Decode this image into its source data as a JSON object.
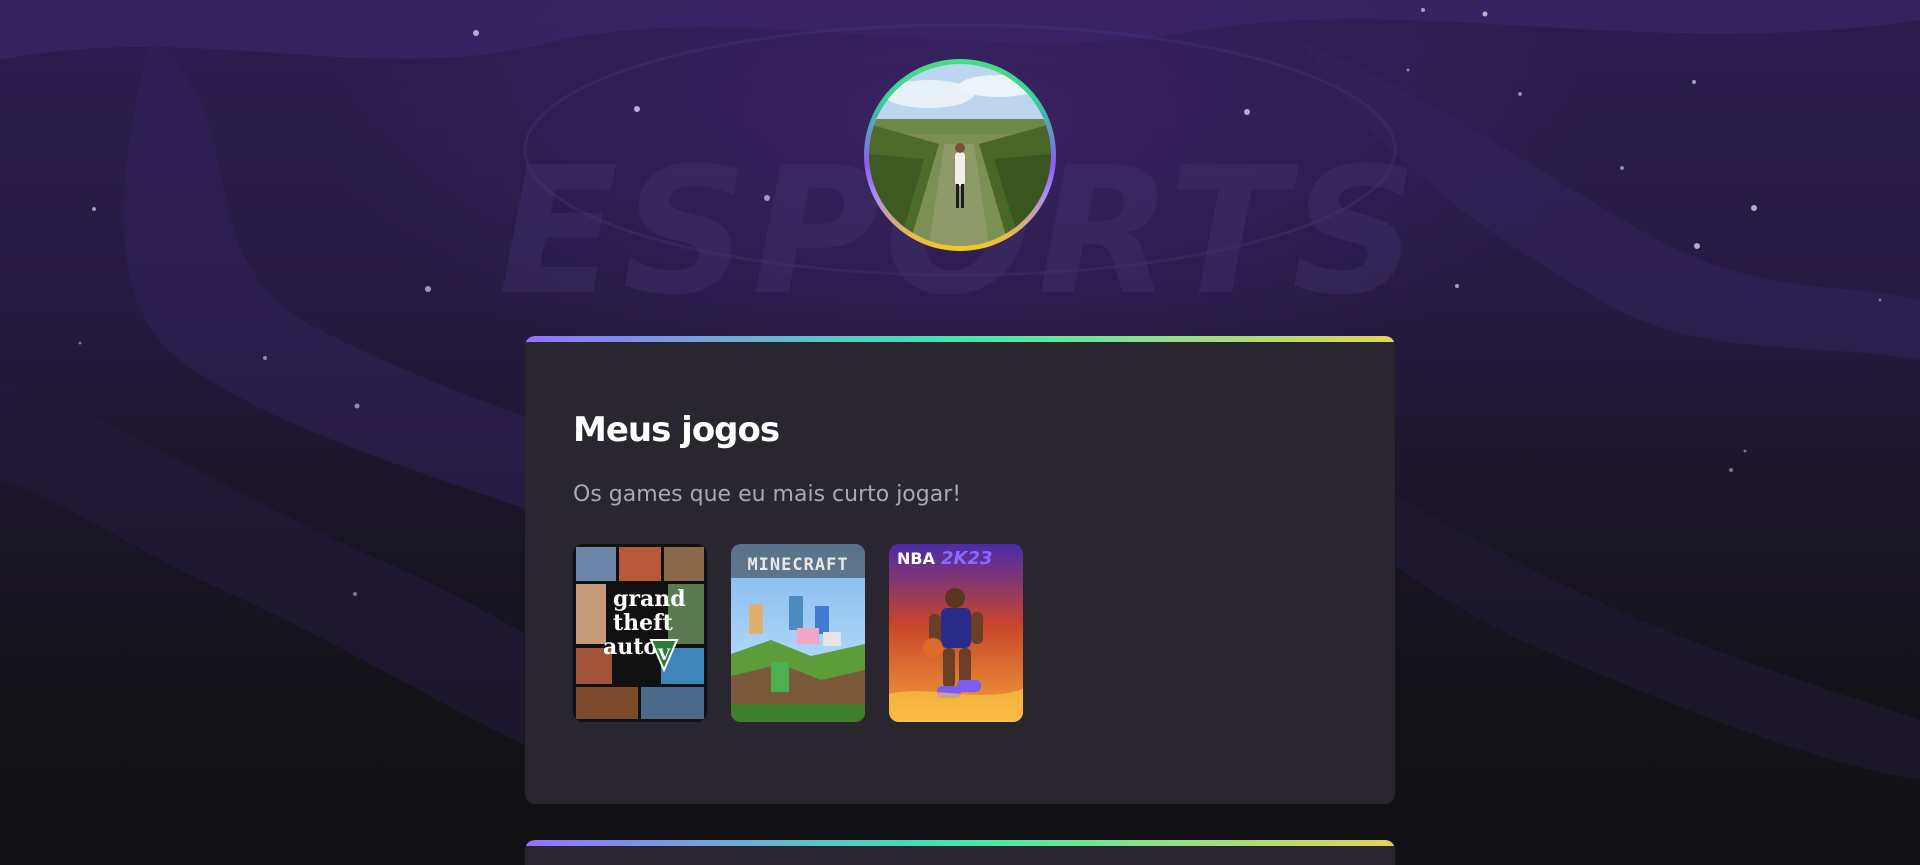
{
  "profile": {
    "avatar_icon": "profile-photo-vineyard"
  },
  "games_card": {
    "title": "Meus jogos",
    "subtitle": "Os games que eu mais curto jogar!",
    "games": [
      {
        "name": "Grand Theft Auto V",
        "cover_text": [
          "grand",
          "theft",
          "auto"
        ],
        "cover_badge": "V"
      },
      {
        "name": "Minecraft",
        "cover_text": "MINECRAFT"
      },
      {
        "name": "NBA 2K23",
        "cover_text_a": "NBA",
        "cover_text_b": "2K23"
      }
    ]
  },
  "background": {
    "watermark": "ESPORTS"
  },
  "colors": {
    "page_bg": "#131217",
    "card_bg": "#29262f",
    "gradient_start": "#9572fc",
    "gradient_mid": "#43e7ad",
    "gradient_end": "#e2d45c",
    "title": "#ffffff",
    "subtitle": "#a9a9b2"
  }
}
